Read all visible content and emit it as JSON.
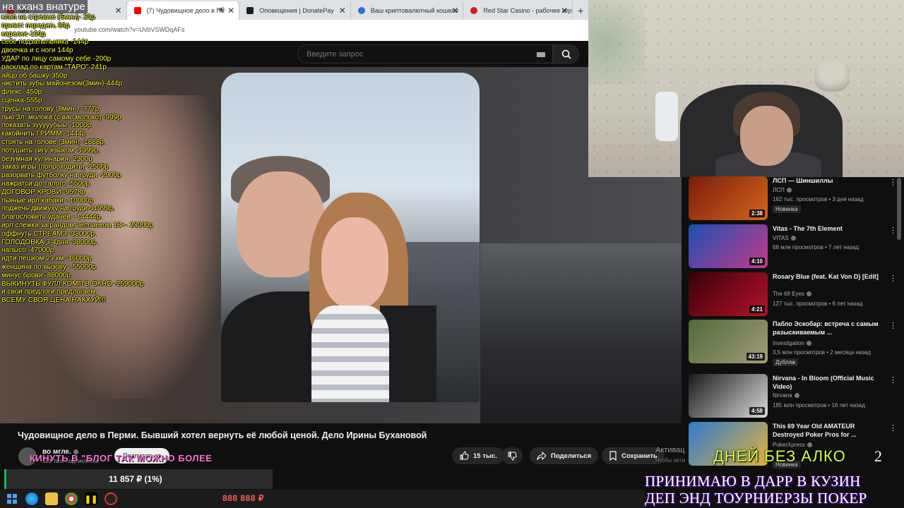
{
  "browser": {
    "tabs": [
      {
        "label": "ard",
        "color": "#ff4444"
      },
      {
        "label": "(7) Чудовищное дело в Пе",
        "color": "#ff0000"
      },
      {
        "label": "Оповещения | DonatePay",
        "color": "#1c1c1c"
      },
      {
        "label": "Ваш криптовалютный кошеле",
        "color": "#2f6fdb"
      },
      {
        "label": "Red Star Casino - рабочее зер",
        "color": "#cc2222"
      }
    ],
    "url": "youtube.com/watch?v=UvbVSWDqAFs"
  },
  "youtube": {
    "search_placeholder": "Введите запрос"
  },
  "overlay": {
    "title": "на кханз внатуре",
    "donations": [
      "клип на стреаме (5мин)- 29р",
      "привет передать 89р",
      "караоке-199р",
      "себе подзатыльника -144р",
      "двоечка и с ноги 144р",
      "УДАР по лицу самому себе -200р",
      "расклад по картам \"ТАРО\"-241р",
      "яйцо об башку-350р",
      "чистить зубы майонезом(3мин)-444р.",
      "флекс- 450р",
      "сценка-555р",
      "трусы на голову (8мин ) -777р",
      "пью 3л. молока (с вас молоко) -999р",
      "показать зууууубыы -1000р",
      "какойнить ГРИММ -1444р",
      "стоять на голове (3мин) -1888р.",
      "потушить сигу языком -1999р.",
      "безумная кулинария- 2300р",
      "заказ игры (попроходить) -2500р",
      "разорвать футболку на груди -2900р",
      "нажратси до талого -5500р",
      "ДОГОВОР КРОВИ -9578р",
      "пьяные ирл кабаки - 10000р",
      "поджечь движуху на груди-11999р.",
      "благословить удачей - 14444р.",
      "ирл слежка за рандом человеком 18+- 23000р",
      "оффнуть СТРЕАМЗ -33000р.",
      "ГОЛОДОВКА 3-4дня -38000р.",
      "налысо -47000р",
      "идти пешком 23 км -46000р",
      "женщина по вызову - 55000р",
      "минус брови -88000р",
      "ВЫКИНУТЬ ФУЛЛ КОМП В ОКНО -259000р",
      "и свои предлоги предлогаем",
      "ВСЕМУ СВОЯ ЦЕНА НАКХУЙ!!!"
    ],
    "marquee": "КИНУТЬ В \"БЛОГ ТАК МОЖНО БОЛЕЕ",
    "counter": "11 857 ₽ (1%)",
    "alko_text": "ДНЕЙ БЕЗ АЛКО",
    "alko_days": "2",
    "banner_line1": "ПРИНИМАЮ В ДАРР В КУЗИН",
    "banner_line2": "ДЕП ЭНД ТОУРНИЕРЗЫ ПОКЕР",
    "money": "888 888 ₽"
  },
  "video": {
    "title": "Чудовищное дело в Перми. Бывший хотел вернуть её любой ценой. Дело Ирины Бухановой",
    "channel": "во мгле.",
    "subs": "103 тыс. подписчиков",
    "subscribe_label": "Подписаться",
    "likes": "15 тыс.",
    "share_label": "Поделиться",
    "save_label": "Сохранить",
    "activate_label": "Активац",
    "activate_sub": "Чтобы акти"
  },
  "recommendations": [
    {
      "title": "ЛСП — Шиншиллы",
      "channel": "ЛСП",
      "meta": "162 тыс. просмотров • 3 дня назад",
      "badge": "Новинка",
      "duration": "2:38",
      "thumb": "#7a1d0c"
    },
    {
      "title": "Vitas - The 7th Element",
      "channel": "VITAS",
      "meta": "68 млн просмотров • 7 лет назад",
      "badge": "",
      "duration": "4:10",
      "thumb": "#1d4fb5"
    },
    {
      "title": "Rosary Blue (feat. Kat Von D) [Edit]",
      "channel": "The 69 Eyes",
      "meta": "127 тыс. просмотров • 6 лет назад",
      "badge": "",
      "duration": "4:21",
      "thumb": "#8b0d1a"
    },
    {
      "title": "Пабло Эскобар: встреча с самым разыскиваемым ...",
      "channel": "Investigation",
      "meta": "3,5 млн просмотров • 2 месяца назад",
      "badge": "Дубляж",
      "duration": "43:19",
      "thumb": "#6b7a4a"
    },
    {
      "title": "Nirvana - In Bloom (Official Music Video)",
      "channel": "Nirvana",
      "meta": "185 млн просмотров • 16 лет назад",
      "badge": "",
      "duration": "4:58",
      "thumb": "#9a9a9a"
    },
    {
      "title": "This 69 Year Old AMATEUR Destroyed Poker Pros for ...",
      "channel": "PokerXpress",
      "meta": "",
      "badge": "Новинка",
      "duration": "",
      "thumb": "#2f7bd1"
    }
  ]
}
